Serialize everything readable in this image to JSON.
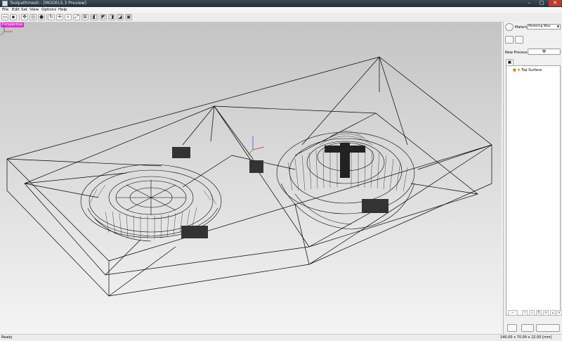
{
  "window": {
    "title": "Toolpathmesh - [MODELS.3 Preview]",
    "minimize": "–",
    "maximize": "□",
    "close": "✕"
  },
  "menu": [
    "File",
    "Edit",
    "Set",
    "View",
    "Options",
    "Help"
  ],
  "toolbar_icons": [
    "open-icon",
    "save-icon",
    "pan-view-icon",
    "orbit-icon",
    "sphere-icon",
    "refresh-icon",
    "move-icon",
    "zoom-icon",
    "zoom-extents-icon",
    "zoom-window-icon",
    "cube-view-icon",
    "top-view-icon",
    "front-view-icon",
    "side-view-icon",
    "iso-view-icon"
  ],
  "viewport": {
    "label": "Perspective"
  },
  "panel": {
    "material_label": "Material",
    "material_value": "Modeling Wax",
    "new_process_label": "New Process",
    "tree_item": "Top Surface"
  },
  "status": {
    "left": "Ready",
    "right": "140.00 x 70.00 x 22.00 [mm]"
  },
  "colors": {
    "viewport_top": "#c4c4c4",
    "viewport_bottom": "#f4f4f4",
    "label_bg": "#e030d0",
    "mesh": "#000000"
  }
}
